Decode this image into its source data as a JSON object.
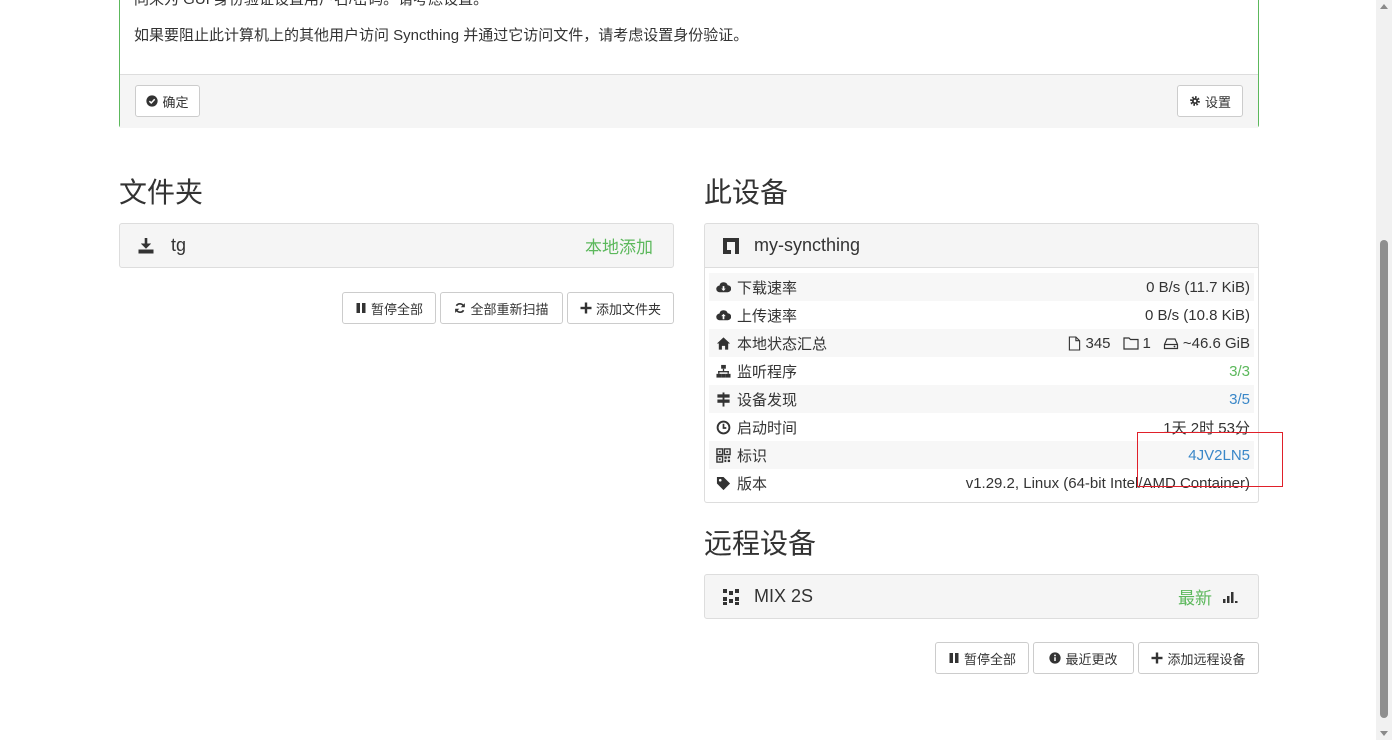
{
  "notice": {
    "line1": "同来为 GUI 身份验证设置用户名/密码。请考虑设置。",
    "line2": "如果要阻止此计算机上的其他用户访问 Syncthing 并通过它访问文件，请考虑设置身份验证。",
    "ok_label": "确定",
    "settings_label": "设置"
  },
  "folders": {
    "heading": "文件夹",
    "items": [
      {
        "name": "tg",
        "status": "本地添加"
      }
    ],
    "buttons": {
      "pause_all": "暂停全部",
      "rescan_all": "全部重新扫描",
      "add_folder": "添加文件夹"
    }
  },
  "this_device": {
    "heading": "此设备",
    "name": "my-syncthing",
    "rows": {
      "download": {
        "label": "下载速率",
        "value": "0 B/s (11.7 KiB)"
      },
      "upload": {
        "label": "上传速率",
        "value": "0 B/s (10.8 KiB)"
      },
      "local_state": {
        "label": "本地状态汇总",
        "files": "345",
        "dirs": "1",
        "size": "~46.6 GiB"
      },
      "listeners": {
        "label": "监听程序",
        "value": "3/3"
      },
      "discovery": {
        "label": "设备发现",
        "value": "3/5"
      },
      "uptime": {
        "label": "启动时间",
        "value": "1天 2时 53分"
      },
      "id": {
        "label": "标识",
        "value": "4JV2LN5"
      },
      "version": {
        "label": "版本",
        "value": "v1.29.2, Linux (64-bit Intel/AMD Container)"
      }
    }
  },
  "remote_devices": {
    "heading": "远程设备",
    "items": [
      {
        "name": "MIX 2S",
        "status": "最新"
      }
    ],
    "buttons": {
      "pause_all": "暂停全部",
      "recent_changes": "最近更改",
      "add_remote": "添加远程设备"
    }
  },
  "colors": {
    "success": "#5cb85c",
    "link": "#3a87c8",
    "highlight": "#e0202a"
  }
}
